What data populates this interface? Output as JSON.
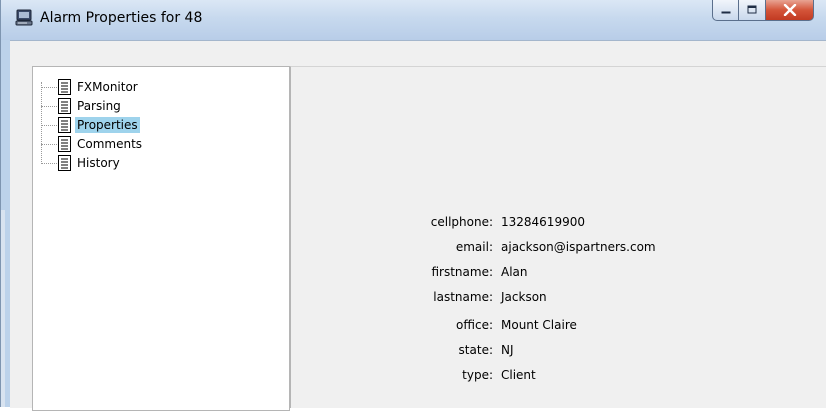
{
  "window": {
    "title": "Alarm Properties for 48",
    "icon": "computer-icon",
    "controls": [
      "minimize-icon",
      "maximize-icon",
      "close-icon"
    ]
  },
  "tree": {
    "items": [
      {
        "label": "FXMonitor",
        "icon": "document-icon",
        "selected": false
      },
      {
        "label": "Parsing",
        "icon": "document-icon",
        "selected": false
      },
      {
        "label": "Properties",
        "icon": "document-icon",
        "selected": true
      },
      {
        "label": "Comments",
        "icon": "document-icon",
        "selected": false
      },
      {
        "label": "History",
        "icon": "document-icon",
        "selected": false
      }
    ],
    "selection_color": "#9ed3ec"
  },
  "properties": [
    {
      "key": "cellphone:",
      "value": "13284619900"
    },
    {
      "key": "email:",
      "value": "ajackson@ispartners.com"
    },
    {
      "key": "firstname:",
      "value": "Alan"
    },
    {
      "key": "lastname:",
      "value": "Jackson"
    },
    {
      "key": "office:",
      "value": "Mount Claire"
    },
    {
      "key": "state:",
      "value": "NJ"
    },
    {
      "key": "type:",
      "value": "Client"
    }
  ]
}
